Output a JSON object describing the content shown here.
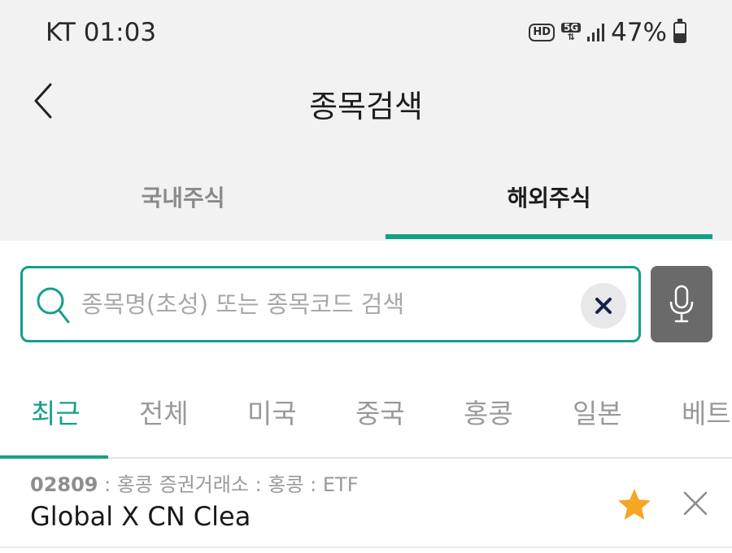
{
  "status_bar": {
    "carrier_time": "KT 01:03",
    "hd_label": "HD",
    "network_label": "5G",
    "battery": "47%"
  },
  "header": {
    "title": "종목검색"
  },
  "market_tabs": [
    {
      "label": "국내주식",
      "active": false
    },
    {
      "label": "해외주식",
      "active": true
    }
  ],
  "search": {
    "placeholder": "종목명(초성) 또는 종목코드 검색",
    "value": ""
  },
  "region_tabs": [
    {
      "label": "최근",
      "active": true
    },
    {
      "label": "전체",
      "active": false
    },
    {
      "label": "미국",
      "active": false
    },
    {
      "label": "중국",
      "active": false
    },
    {
      "label": "홍콩",
      "active": false
    },
    {
      "label": "일본",
      "active": false
    },
    {
      "label": "베트남",
      "active": false
    }
  ],
  "recent_items": [
    {
      "code": "02809",
      "meta": " : 홍콩 증권거래소 : 홍콩 : ETF",
      "name": "Global X CN Clea",
      "favorited": true
    }
  ],
  "colors": {
    "accent": "#14a089",
    "star": "#f5a623",
    "mic_bg": "#6a6a6a",
    "header_bg": "#f2f2f2"
  },
  "icons": [
    "back-arrow-icon",
    "search-icon",
    "clear-icon",
    "microphone-icon",
    "star-icon",
    "close-icon"
  ]
}
